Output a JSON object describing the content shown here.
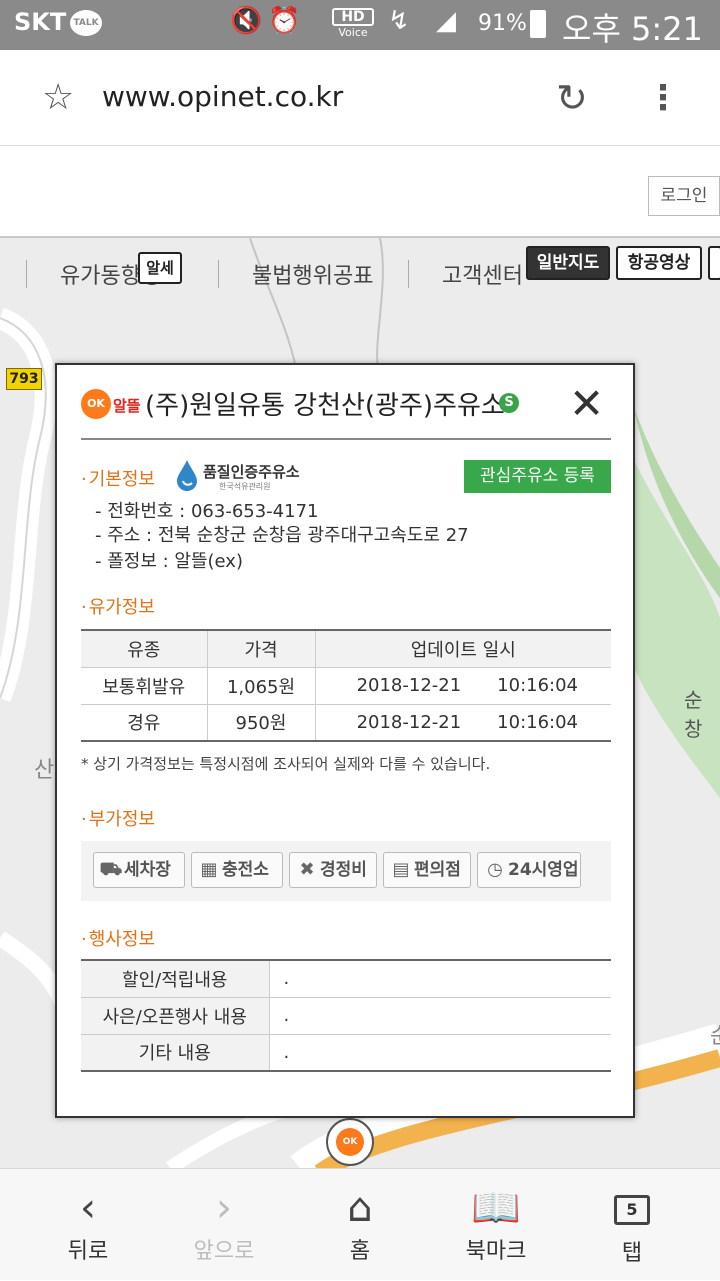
{
  "status_bar": {
    "carrier": "SKT",
    "talk": "TALK",
    "hd": "HD",
    "voice": "Voice",
    "battery": "91%",
    "time": "오후 5:21"
  },
  "browser": {
    "url": "www.opinet.co.kr"
  },
  "site": {
    "login": "로그인",
    "menu": [
      "유가동향정보",
      "불법행위공표",
      "고객센터"
    ],
    "overlap_badge": "알세",
    "map_types": [
      "일반지도",
      "항공영상"
    ]
  },
  "map": {
    "road_number": "793",
    "labels": [
      "순창",
      "산",
      "순"
    ]
  },
  "popup": {
    "brand": "알뜰",
    "brand_logo": "OK",
    "station_name": "(주)원일유통 강천산(광주)주유소",
    "self_badge": "S",
    "basic": {
      "title": "기본정보",
      "cert": "품질인증주유소",
      "cert_org": "한국석유관리원",
      "fav_button": "관심주유소 등록",
      "phone": "- 전화번호 : 063-653-4171",
      "address": "- 주소 : 전북 순창군 순창읍 광주대구고속도로 27",
      "pole": "- 폴정보 : 알뜰(ex)"
    },
    "prices": {
      "title": "유가정보",
      "headers": [
        "유종",
        "가격",
        "업데이트 일시"
      ],
      "rows": [
        {
          "fuel": "보통휘발유",
          "price": "1,065원",
          "date": "2018-12-21",
          "time": "10:16:04"
        },
        {
          "fuel": "경유",
          "price": "950원",
          "date": "2018-12-21",
          "time": "10:16:04"
        }
      ],
      "note": "* 상기 가격정보는 특정시점에 조사되어 실제와 다를 수 있습니다."
    },
    "extra": {
      "title": "부가정보",
      "services": [
        "세차장",
        "충전소",
        "경정비",
        "편의점",
        "24시영업"
      ]
    },
    "events": {
      "title": "행사정보",
      "rows": [
        {
          "label": "할인/적립내용",
          "value": "."
        },
        {
          "label": "사은/오픈행사 내용",
          "value": "."
        },
        {
          "label": "기타 내용",
          "value": "."
        }
      ]
    }
  },
  "bottom_nav": {
    "back": "뒤로",
    "forward": "앞으로",
    "home": "홈",
    "bookmark": "북마크",
    "tabs": "탭",
    "tab_count": "5"
  }
}
